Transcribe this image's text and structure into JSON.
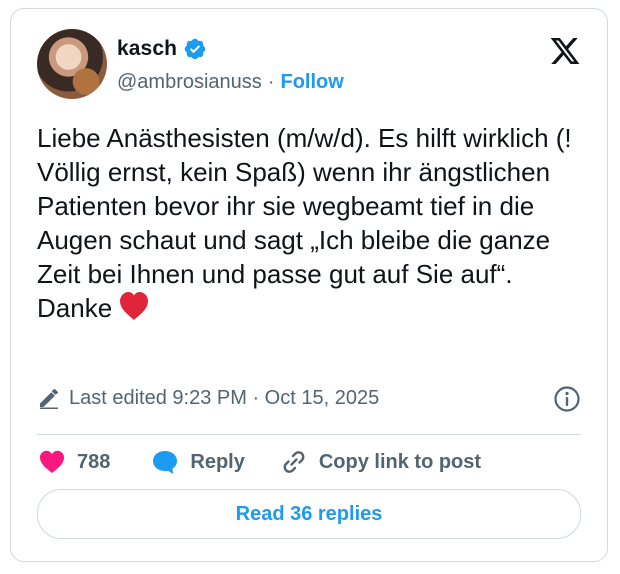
{
  "author": {
    "name": "kasch",
    "handle": "@ambrosianuss",
    "separator": "·",
    "follow_label": "Follow",
    "verified": true
  },
  "post": {
    "lines": [
      "Liebe Anästhesisten (m/w/d). Es hilft wirklich (! Völlig ernst, kein Spaß) wenn ihr ängstlichen Patienten bevor ihr sie wegbeamt tief in die Augen schaut und sagt „Ich bleibe die ganze Zeit bei Ihnen und passe gut auf Sie auf“.",
      "Danke"
    ],
    "emoji": "red-heart"
  },
  "meta": {
    "edited_text": "Last edited 9:23 PM · Oct 15, 2025",
    "icons": [
      "pencil-icon",
      "info-icon",
      "x-logo-icon"
    ]
  },
  "actions": {
    "likes_count": "788",
    "reply_label": "Reply",
    "copy_label": "Copy link to post"
  },
  "footer": {
    "read_replies_label": "Read 36 replies"
  },
  "colors": {
    "accent": "#1d9bf0",
    "like": "#f91880",
    "heart_emoji": "#e0243a",
    "text": "#0f1419",
    "muted": "#536471",
    "border": "#cfd9de"
  }
}
